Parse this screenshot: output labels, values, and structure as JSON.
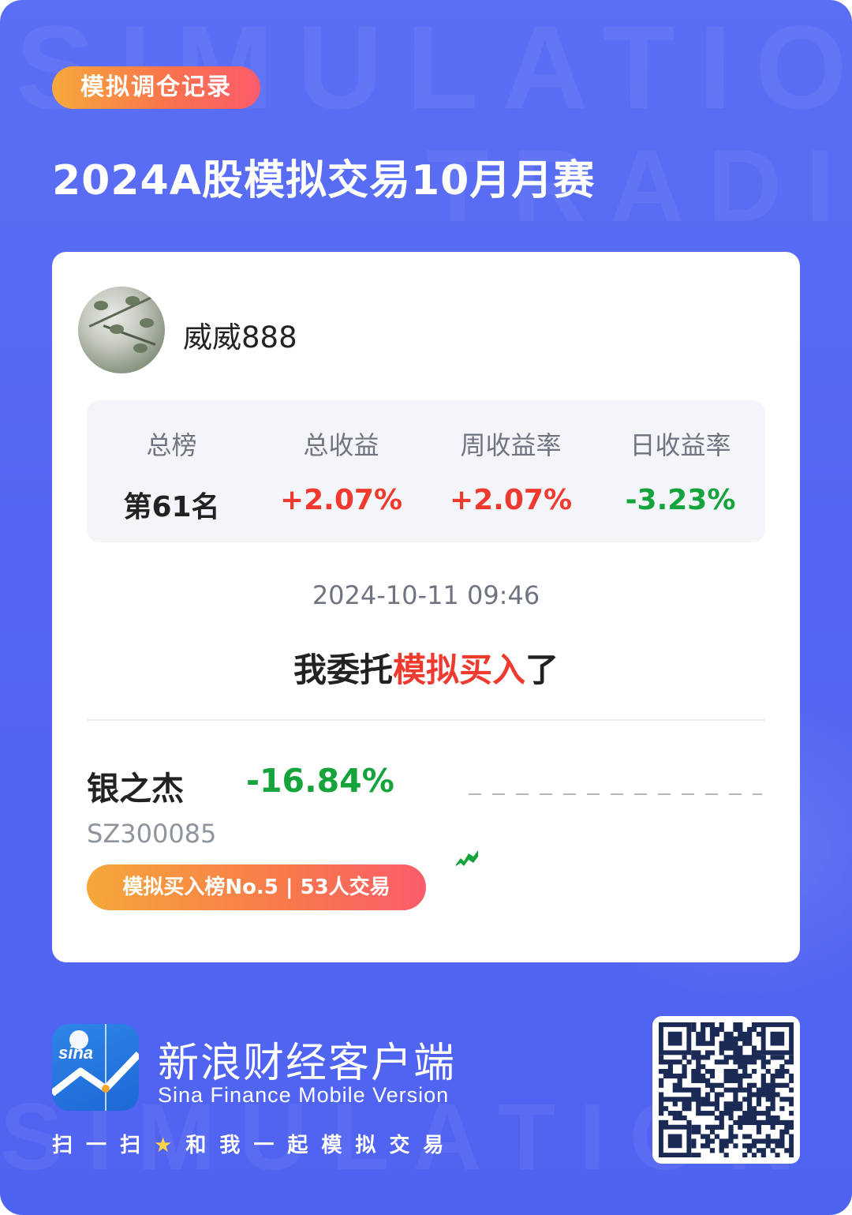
{
  "header": {
    "tag": "模拟调仓记录",
    "title": "2024A股模拟交易10月月赛"
  },
  "user": {
    "name": "威威888"
  },
  "stats": [
    {
      "label": "总榜",
      "value": "第61名",
      "color": "#222222"
    },
    {
      "label": "总收益",
      "value": "+2.07%",
      "color": "#ef3b2f"
    },
    {
      "label": "周收益率",
      "value": "+2.07%",
      "color": "#ef3b2f"
    },
    {
      "label": "日收益率",
      "value": "-3.23%",
      "color": "#15a33c"
    }
  ],
  "record": {
    "datetime": "2024-10-11 09:46",
    "action_prefix": "我委托",
    "action_highlight": "模拟买入",
    "action_suffix": "了"
  },
  "stock": {
    "name": "银之杰",
    "change": "-16.84%",
    "code": "SZ300085",
    "badge": "模拟买入榜No.5 | 53人交易"
  },
  "footer": {
    "app_name": "新浪财经客户端",
    "app_name_en": "Sina Finance Mobile Version",
    "logo_text": "sina",
    "slogan_part1": "扫一扫",
    "slogan_star": "★",
    "slogan_part2": "和我一起模拟交易"
  },
  "colors": {
    "background": "#5466f3",
    "accent_red": "#ef3b2f",
    "accent_green": "#15a33c",
    "tag_gradient_start": "#f6a93b",
    "tag_gradient_end": "#fa5c6b"
  },
  "watermark": [
    "SIMULATION",
    "TRADING",
    "SIMULATION"
  ]
}
